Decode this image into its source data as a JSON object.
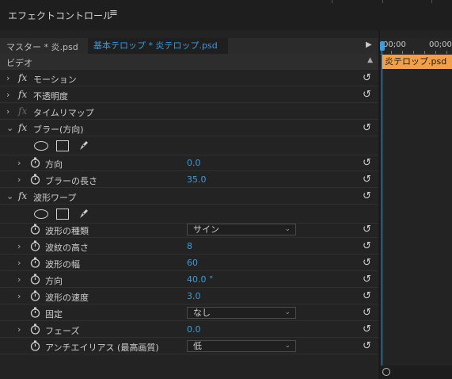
{
  "header": {
    "title": "エフェクトコントロール",
    "menu_icon": "≡"
  },
  "source": {
    "master": "マスター * 炎.psd",
    "clip": "基本テロップ * 炎テロップ.psd",
    "play_icon": "▶"
  },
  "category": {
    "label": "ビデオ",
    "collapse_icon": "▲"
  },
  "timeline": {
    "tc_start": "00;00",
    "tc_next": "00;00",
    "clip_label": "炎テロップ.psd"
  },
  "glyphs": {
    "chevron_right": "›",
    "chevron_down": "⌄",
    "fx": "fx",
    "reset": "↺",
    "dropdown": "⌄"
  },
  "rows": {
    "motion": {
      "label": "モーション"
    },
    "opacity": {
      "label": "不透明度"
    },
    "time_remap": {
      "label": "タイムリマップ"
    },
    "blur": {
      "label": "ブラー(方向)"
    },
    "blur_direction": {
      "label": "方向",
      "value": "0.0"
    },
    "blur_length": {
      "label": "ブラーの長さ",
      "value": "35.0"
    },
    "wave_warp": {
      "label": "波形ワープ"
    },
    "wave_type": {
      "label": "波形の種類",
      "value": "サイン"
    },
    "wave_height": {
      "label": "波紋の高さ",
      "value": "8"
    },
    "wave_width": {
      "label": "波形の幅",
      "value": "60"
    },
    "wave_direction": {
      "label": "方向",
      "value": "40.0 °"
    },
    "wave_speed": {
      "label": "波形の速度",
      "value": "3.0"
    },
    "pinning": {
      "label": "固定",
      "value": "なし"
    },
    "phase": {
      "label": "フェーズ",
      "value": "0.0"
    },
    "antialias": {
      "label": "アンチエイリアス (最高画質)",
      "value": "低"
    }
  }
}
